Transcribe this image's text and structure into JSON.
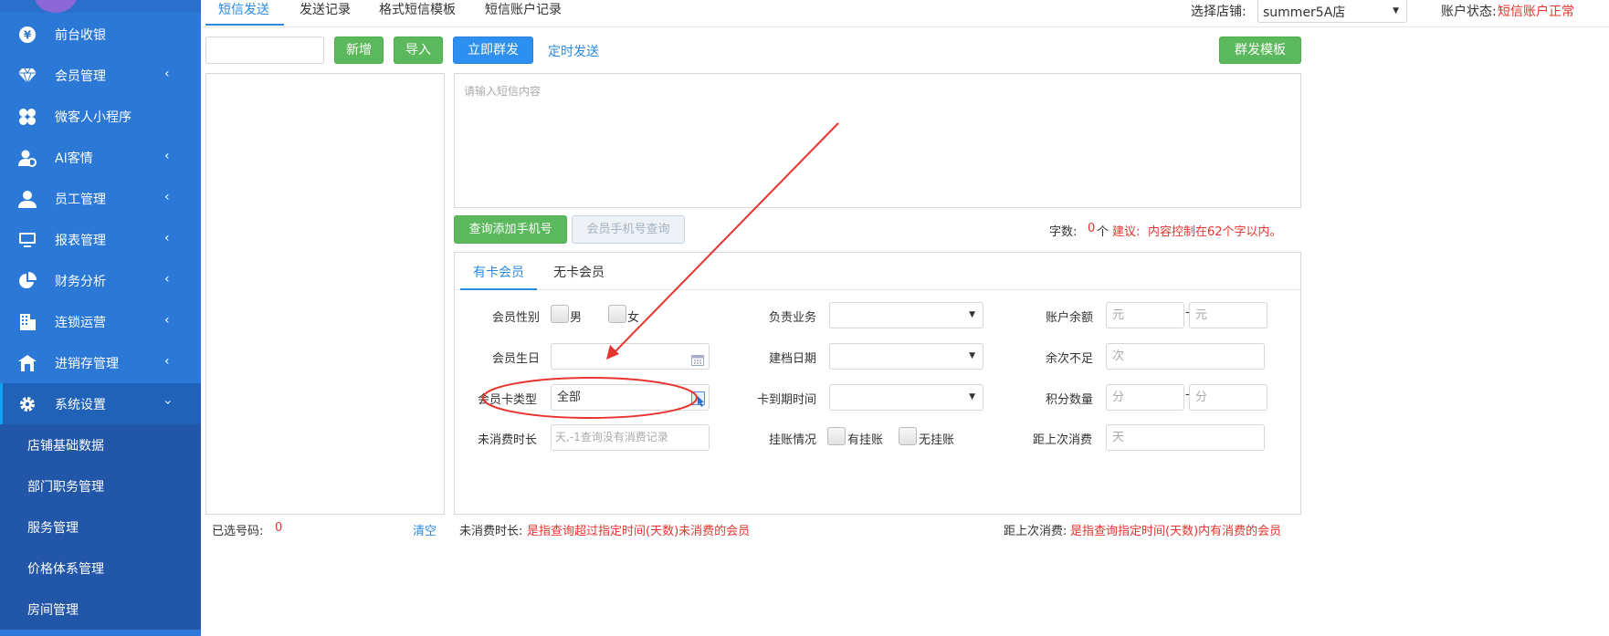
{
  "sidebar": {
    "items": [
      {
        "label": "前台收银",
        "icon": "yen-coin-icon",
        "has_chevron": false
      },
      {
        "label": "会员管理",
        "icon": "diamond-icon",
        "has_chevron": true
      },
      {
        "label": "微客人小程序",
        "icon": "mini-program-icon",
        "has_chevron": false
      },
      {
        "label": "AI客情",
        "icon": "user-ai-icon",
        "has_chevron": true
      },
      {
        "label": "员工管理",
        "icon": "user-icon",
        "has_chevron": true
      },
      {
        "label": "报表管理",
        "icon": "monitor-icon",
        "has_chevron": true
      },
      {
        "label": "财务分析",
        "icon": "pie-chart-icon",
        "has_chevron": true
      },
      {
        "label": "连锁运营",
        "icon": "building-icon",
        "has_chevron": true
      },
      {
        "label": "进销存管理",
        "icon": "warehouse-icon",
        "has_chevron": true
      },
      {
        "label": "系统设置",
        "icon": "gear-icon",
        "has_chevron": true,
        "expanded": true
      }
    ],
    "sub_items": [
      "店铺基础数据",
      "部门职务管理",
      "服务管理",
      "价格体系管理",
      "房间管理"
    ]
  },
  "tabs": [
    "短信发送",
    "发送记录",
    "格式短信模板",
    "短信账户记录"
  ],
  "header": {
    "store_label": "选择店铺:",
    "store_value": "summer5A店",
    "account_label": "账户状态:",
    "account_status": "短信账户正常"
  },
  "toolbar": {
    "add_label": "新增",
    "import_label": "导入",
    "send_now_label": "立即群发",
    "schedule_label": "定时发送",
    "template_label": "群发模板"
  },
  "message": {
    "placeholder": "请输入短信内容"
  },
  "query": {
    "add_phone_label": "查询添加手机号",
    "member_phone_label": "会员手机号查询",
    "count_label": "字数:",
    "count_value": "0",
    "count_unit": "个",
    "suggest_label": "建议:",
    "suggest_text": "内容控制在62个字以内。"
  },
  "filter_tabs": [
    "有卡会员",
    "无卡会员"
  ],
  "filters": {
    "gender_label": "会员性别",
    "male": "男",
    "female": "女",
    "business_label": "负责业务",
    "balance_label": "账户余额",
    "balance_unit": "元",
    "birthday_label": "会员生日",
    "created_label": "建档日期",
    "remaining_label": "余次不足",
    "remaining_unit": "次",
    "card_type_label": "会员卡类型",
    "card_type_value": "全部",
    "expire_label": "卡到期时间",
    "points_label": "积分数量",
    "points_unit": "分",
    "no_consume_label": "未消费时长",
    "no_consume_placeholder": "天,-1查询没有消费记录",
    "credit_label": "挂账情况",
    "has_credit": "有挂账",
    "no_credit": "无挂账",
    "last_consume_label": "距上次消费",
    "last_consume_unit": "天",
    "dash": "-"
  },
  "footer": {
    "selected_label": "已选号码:",
    "selected_count": "0",
    "clear_label": "清空",
    "note1_label": "未消费时长:",
    "note1_text": "是指查询超过指定时间(天数)未消费的会员",
    "note2_label": "距上次消费:",
    "note2_text": "是指查询指定时间(天数)内有消费的会员"
  },
  "colors": {
    "sidebar": "#2b78d6",
    "accent_blue": "#2b8ae0",
    "green": "#5cb85c",
    "red": "#e8332e"
  }
}
